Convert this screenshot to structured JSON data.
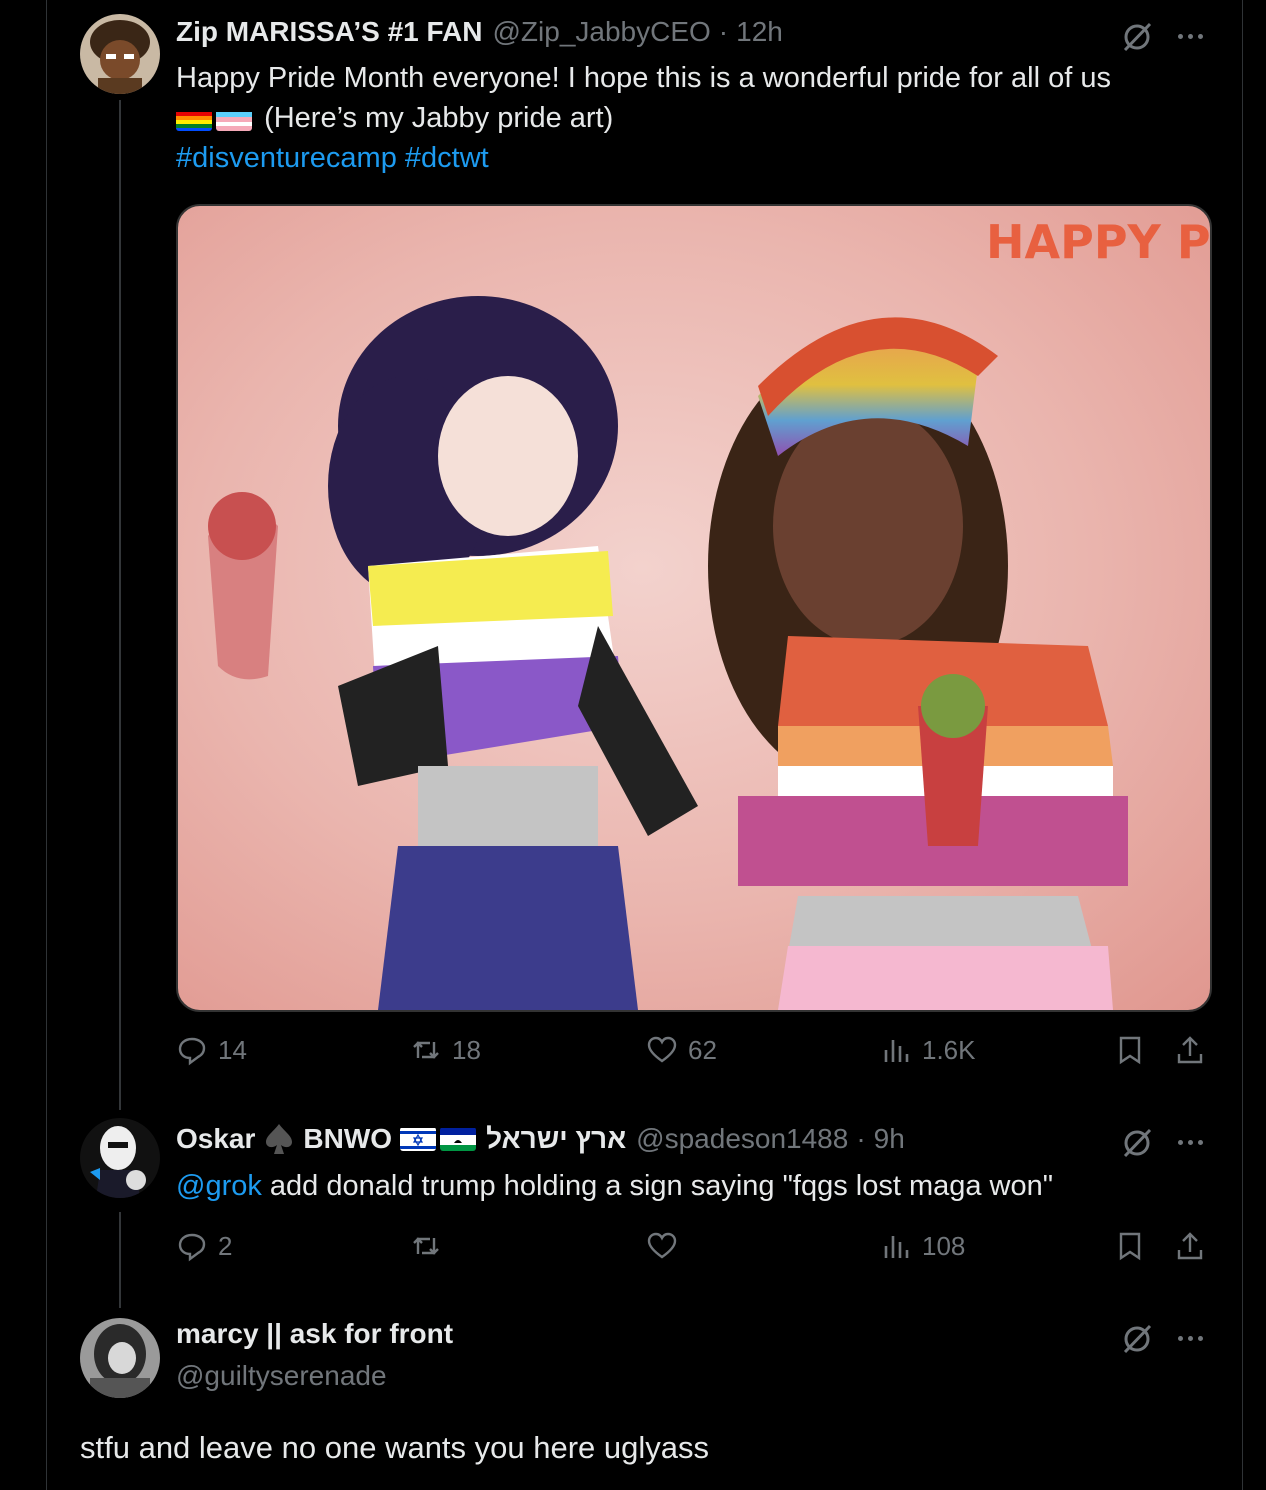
{
  "tweets": [
    {
      "display_name": "Zip MARISSA’S #1 FAN",
      "handle": "@Zip_JabbyCEO",
      "time": "12h",
      "text_line1": "Happy Pride Month everyone! I hope this is a wonderful pride for all of us",
      "text_line2": "(Here’s my Jabby pride art)",
      "hashtags": [
        "#disventurecamp",
        "#dctwt"
      ],
      "media_text": "HAPPY PRIDE !",
      "stats": {
        "replies": "14",
        "reposts": "18",
        "likes": "62",
        "views": "1.6K"
      }
    },
    {
      "display_name": "Oskar",
      "display_name_2": "BNWO",
      "hebrew": "ארץ ישראל",
      "handle": "@spadeson1488",
      "time": "9h",
      "mention": "@grok",
      "text": " add donald trump holding a sign saying \"fqgs lost maga won\"",
      "stats": {
        "replies": "2",
        "reposts": "",
        "likes": "",
        "views": "108"
      }
    },
    {
      "display_name": "marcy || ask for front",
      "handle": "@guiltyserenade",
      "text": "stfu and leave no one wants you here uglyass"
    }
  ],
  "colors": {
    "background": "#000000",
    "link": "#1d9bf0",
    "muted": "#71767b",
    "text": "#e7e9ea"
  },
  "icons": [
    "grok-icon",
    "more-icon",
    "reply-icon",
    "repost-icon",
    "like-icon",
    "views-icon",
    "bookmark-icon",
    "share-icon"
  ]
}
